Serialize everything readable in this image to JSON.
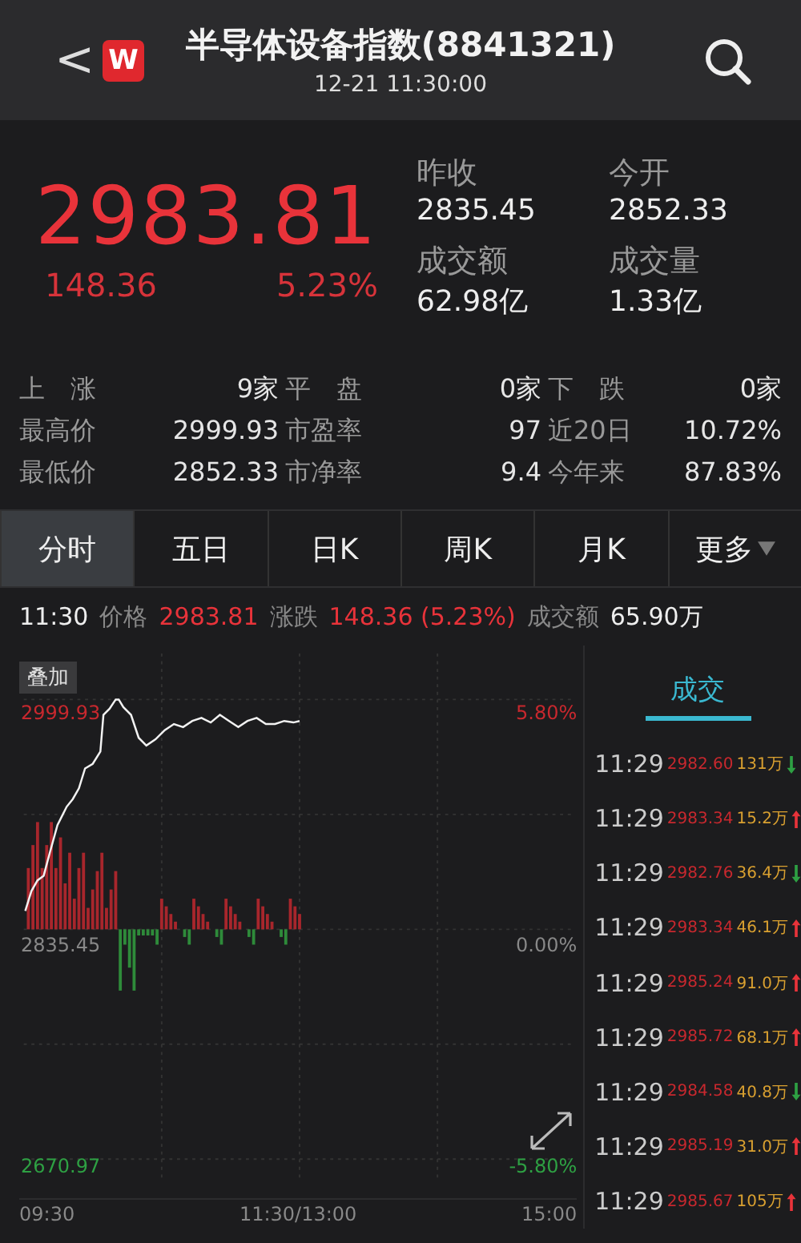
{
  "header": {
    "back": "<",
    "logo": "W",
    "title": "半导体设备指数(8841321)",
    "time": "12-21 11:30:00"
  },
  "quote": {
    "price": "2983.81",
    "change": "148.36",
    "percent": "5.23%",
    "stats": [
      {
        "label": "昨收",
        "value": "2835.45"
      },
      {
        "label": "今开",
        "value": "2852.33"
      },
      {
        "label": "成交额",
        "value": "62.98亿"
      },
      {
        "label": "成交量",
        "value": "1.33亿"
      }
    ]
  },
  "summary": [
    [
      {
        "label": "上　涨",
        "value": "9家"
      },
      {
        "label": "平　盘",
        "value": "0家"
      },
      {
        "label": "下　跌",
        "value": "0家"
      }
    ],
    [
      {
        "label": "最高价",
        "value": "2999.93"
      },
      {
        "label": "市盈率",
        "value": "97"
      },
      {
        "label": "近20日",
        "value": "10.72%"
      }
    ],
    [
      {
        "label": "最低价",
        "value": "2852.33"
      },
      {
        "label": "市净率",
        "value": "9.4"
      },
      {
        "label": "今年来",
        "value": "87.83%"
      }
    ]
  ],
  "tabs": [
    {
      "label": "分时",
      "selected": true
    },
    {
      "label": "五日",
      "selected": false
    },
    {
      "label": "日K",
      "selected": false
    },
    {
      "label": "周K",
      "selected": false
    },
    {
      "label": "月K",
      "selected": false
    },
    {
      "label": "更多",
      "selected": false,
      "kind": "dropdown"
    }
  ],
  "info": {
    "time": "11:30",
    "price_label": "价格",
    "price": "2983.81",
    "change_label": "涨跌",
    "change": "148.36 (5.23%)",
    "amount_label": "成交额",
    "amount": "65.90万"
  },
  "chart": {
    "overlay": "叠加",
    "high": "2999.93",
    "high_pct": "5.80%",
    "mid": "2835.45",
    "mid_pct": "0.00%",
    "low": "2670.97",
    "low_pct": "-5.80%",
    "x_labels": [
      "09:30",
      "11:30/13:00",
      "15:00"
    ]
  },
  "trades_tab": "成交",
  "trades": [
    {
      "time": "11:29",
      "price": "2982.60",
      "volume": "131万",
      "kind": "down"
    },
    {
      "time": "11:29",
      "price": "2983.34",
      "volume": "15.2万",
      "kind": "up"
    },
    {
      "time": "11:29",
      "price": "2982.76",
      "volume": "36.4万",
      "kind": "down"
    },
    {
      "time": "11:29",
      "price": "2983.34",
      "volume": "46.1万",
      "kind": "up"
    },
    {
      "time": "11:29",
      "price": "2985.24",
      "volume": "91.0万",
      "kind": "up"
    },
    {
      "time": "11:29",
      "price": "2985.72",
      "volume": "68.1万",
      "kind": "up"
    },
    {
      "time": "11:29",
      "price": "2984.58",
      "volume": "40.8万",
      "kind": "down"
    },
    {
      "time": "11:29",
      "price": "2985.19",
      "volume": "31.0万",
      "kind": "up"
    },
    {
      "time": "11:29",
      "price": "2985.67",
      "volume": "105万",
      "kind": "up"
    }
  ]
}
